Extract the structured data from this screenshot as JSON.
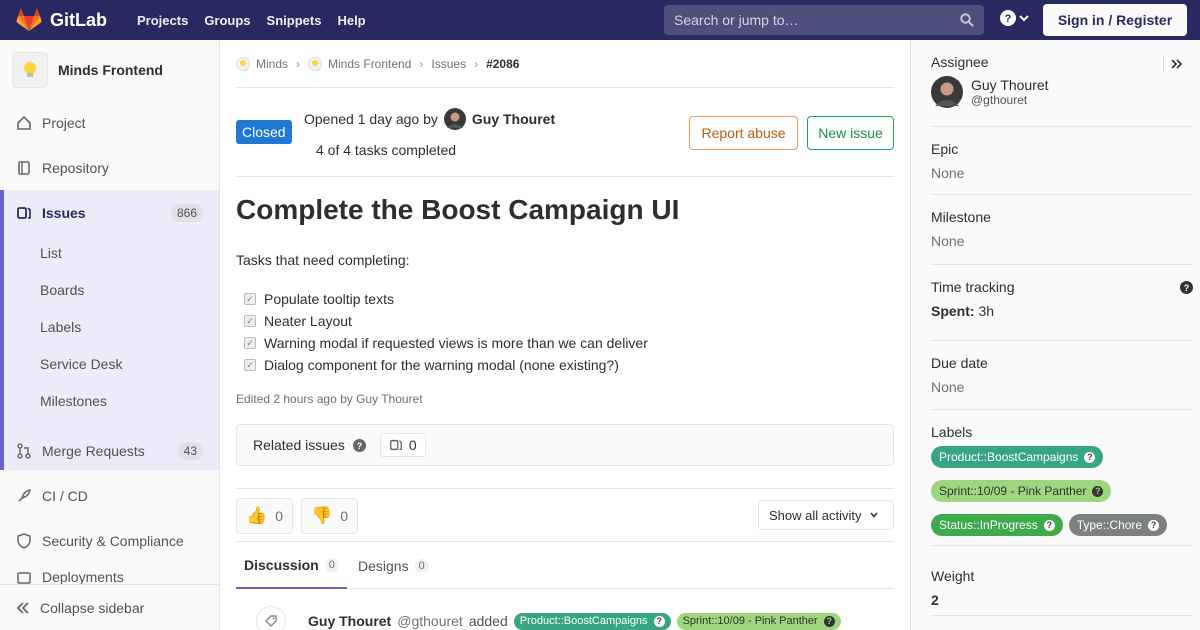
{
  "navbar": {
    "brand": "GitLab",
    "links": [
      "Projects",
      "Groups",
      "Snippets",
      "Help"
    ],
    "search_placeholder": "Search or jump to…",
    "signin": "Sign in / Register",
    "colors": {
      "bg": "#292961"
    }
  },
  "sidebar": {
    "project_name": "Minds Frontend",
    "items": [
      {
        "label": "Project",
        "icon": "project-icon"
      },
      {
        "label": "Repository",
        "icon": "repository-icon"
      },
      {
        "label": "Issues",
        "icon": "issues-icon",
        "count": "866",
        "active": true
      },
      {
        "label": "Merge Requests",
        "icon": "merge-request-icon",
        "count": "43"
      },
      {
        "label": "CI / CD",
        "icon": "rocket-icon"
      },
      {
        "label": "Security & Compliance",
        "icon": "shield-icon"
      },
      {
        "label": "Deployments",
        "icon": "deployments-icon"
      }
    ],
    "sub_items": [
      "List",
      "Boards",
      "Labels",
      "Service Desk",
      "Milestones"
    ],
    "collapse": "Collapse sidebar"
  },
  "breadcrumb": [
    "Minds",
    "Minds Frontend",
    "Issues",
    "#2086"
  ],
  "issue": {
    "status": "Closed",
    "opened_prefix": "Opened 1 day ago by",
    "author": "Guy Thouret",
    "tasks_completed": "4 of 4 tasks completed",
    "report_abuse": "Report abuse",
    "new_issue": "New issue",
    "title": "Complete the Boost Campaign UI",
    "description": "Tasks that need completing:",
    "tasks": [
      "Populate tooltip texts",
      "Neater Layout",
      "Warning modal if requested views is more than we can deliver",
      "Dialog component for the warning modal (none existing?)"
    ],
    "edited": "Edited 2 hours ago by Guy Thouret",
    "related_label": "Related issues",
    "related_count": "0",
    "thumbs_up": "0",
    "thumbs_down": "0",
    "activity_filter": "Show all activity",
    "tabs": [
      {
        "label": "Discussion",
        "count": "0"
      },
      {
        "label": "Designs",
        "count": "0"
      }
    ],
    "note": {
      "author": "Guy Thouret",
      "handle": "@gthouret",
      "action": "added"
    }
  },
  "right_sidebar": {
    "assignee_title": "Assignee",
    "assignee_name": "Guy Thouret",
    "assignee_handle": "@gthouret",
    "epic_title": "Epic",
    "epic_value": "None",
    "milestone_title": "Milestone",
    "milestone_value": "None",
    "time_title": "Time tracking",
    "spent_label": "Spent:",
    "spent_value": "3h",
    "due_title": "Due date",
    "due_value": "None",
    "labels_title": "Labels",
    "labels": [
      {
        "text": "Product::BoostCampaigns",
        "color": "#36a583"
      },
      {
        "text": "Sprint::10/09 - Pink Panther",
        "color": "#9ed57f"
      },
      {
        "text": "Status::InProgress",
        "color": "#3faa4c"
      },
      {
        "text": "Type::Chore",
        "color": "#7d8080"
      }
    ],
    "weight_title": "Weight",
    "weight_value": "2"
  }
}
